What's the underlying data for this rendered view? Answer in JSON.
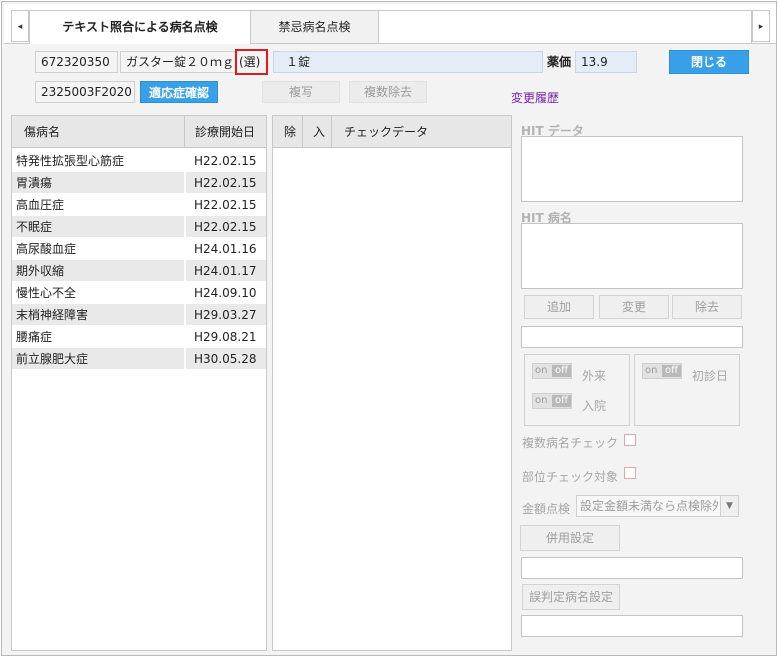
{
  "tabs": {
    "left_arrow": "◂",
    "right_arrow": "▸",
    "items": [
      {
        "label": "テキスト照合による病名点検"
      },
      {
        "label": "禁忌病名点検"
      }
    ]
  },
  "drug": {
    "code": "672320350",
    "name": "ガスター錠２０ｍｇ",
    "marker": "(選)",
    "quantity": "１錠",
    "price_label": "薬価",
    "price": "13.9",
    "close_label": "閉じる",
    "yj_code": "2325003F2020",
    "indication_label": "適応症確認",
    "copy_label": "複写",
    "multi_remove_label": "複数除去",
    "history_link": "変更履歴"
  },
  "disease_table": {
    "columns": [
      "傷病名",
      "診療開始日"
    ],
    "rows": [
      {
        "name": "特発性拡張型心筋症",
        "date": "H22.02.15"
      },
      {
        "name": "胃潰瘍",
        "date": "H22.02.15"
      },
      {
        "name": "高血圧症",
        "date": "H22.02.15"
      },
      {
        "name": "不眠症",
        "date": "H22.02.15"
      },
      {
        "name": "高尿酸血症",
        "date": "H24.01.16"
      },
      {
        "name": "期外収縮",
        "date": "H24.01.17"
      },
      {
        "name": "慢性心不全",
        "date": "H24.09.10"
      },
      {
        "name": "末梢神経障害",
        "date": "H29.03.27"
      },
      {
        "name": "腰痛症",
        "date": "H29.08.21"
      },
      {
        "name": "前立腺肥大症",
        "date": "H30.05.28"
      }
    ]
  },
  "check_table": {
    "columns": [
      "除",
      "入",
      "チェックデータ"
    ]
  },
  "hit": {
    "data_title": "HIT データ",
    "name_title": "HIT 病名",
    "add_label": "追加",
    "change_label": "変更",
    "remove_label": "除去"
  },
  "toggles": {
    "on": "on",
    "off": "off",
    "outpatient": "外来",
    "inpatient": "入院",
    "first_visit": "初診日"
  },
  "options": {
    "multi_check_label": "複数病名チェック",
    "site_check_label": "部位チェック対象",
    "amount_label": "金額点検",
    "amount_value": "設定金額未満なら点検除外",
    "combined_label": "併用設定",
    "misjudge_label": "誤判定病名設定"
  }
}
